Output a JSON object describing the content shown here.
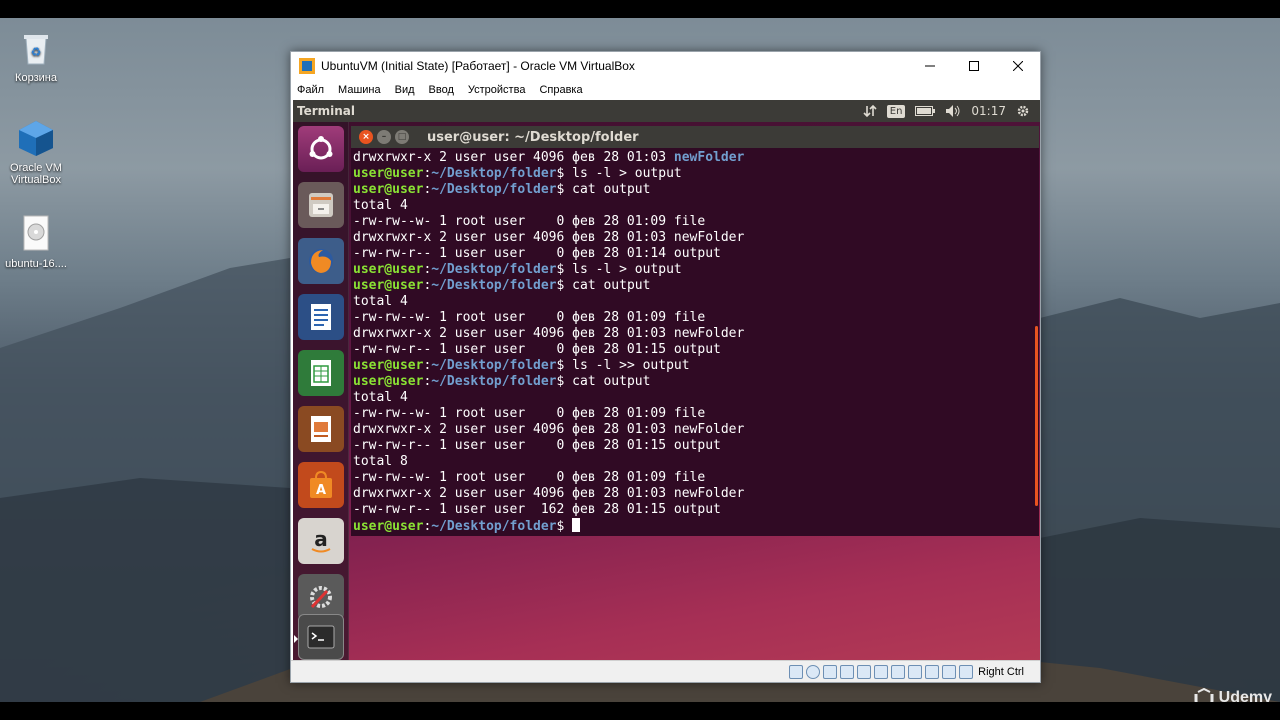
{
  "host_desktop": {
    "icons": [
      {
        "label": "Корзина",
        "icon": "recycle-bin-icon"
      },
      {
        "label": "Oracle VM VirtualBox",
        "icon": "virtualbox-icon"
      },
      {
        "label": "ubuntu-16....",
        "icon": "disk-image-icon"
      }
    ]
  },
  "vbox": {
    "title": "UbuntuVM (Initial State) [Работает] - Oracle VM VirtualBox",
    "menu": [
      "Файл",
      "Машина",
      "Вид",
      "Ввод",
      "Устройства",
      "Справка"
    ],
    "host_key": "Right Ctrl"
  },
  "guest": {
    "topbar": {
      "title": "Terminal",
      "language": "En",
      "time": "01:17"
    },
    "launcher": [
      "ubuntu-dash-icon",
      "files-icon",
      "firefox-icon",
      "writer-icon",
      "calc-icon",
      "impress-icon",
      "software-center-icon",
      "amazon-icon",
      "system-settings-icon",
      "terminal-icon"
    ],
    "terminal": {
      "title": "user@user: ~/Desktop/folder",
      "prompt_user": "user@user",
      "prompt_path": "~/Desktop/folder",
      "lines": [
        {
          "type": "dirline",
          "text": "drwxrwxr-x 2 user user 4096 фев 28 01:03 ",
          "dir": "newFolder"
        },
        {
          "type": "prompt",
          "cmd": " ls -l > output"
        },
        {
          "type": "prompt",
          "cmd": " cat output"
        },
        {
          "type": "out",
          "text": "total 4"
        },
        {
          "type": "out",
          "text": "-rw-rw--w- 1 root user    0 фев 28 01:09 file"
        },
        {
          "type": "out",
          "text": "drwxrwxr-x 2 user user 4096 фев 28 01:03 newFolder"
        },
        {
          "type": "out",
          "text": "-rw-rw-r-- 1 user user    0 фев 28 01:14 output"
        },
        {
          "type": "prompt",
          "cmd": " ls -l > output"
        },
        {
          "type": "prompt",
          "cmd": " cat output"
        },
        {
          "type": "out",
          "text": "total 4"
        },
        {
          "type": "out",
          "text": "-rw-rw--w- 1 root user    0 фев 28 01:09 file"
        },
        {
          "type": "out",
          "text": "drwxrwxr-x 2 user user 4096 фев 28 01:03 newFolder"
        },
        {
          "type": "out",
          "text": "-rw-rw-r-- 1 user user    0 фев 28 01:15 output"
        },
        {
          "type": "prompt",
          "cmd": " ls -l >> output"
        },
        {
          "type": "prompt",
          "cmd": " cat output"
        },
        {
          "type": "out",
          "text": "total 4"
        },
        {
          "type": "out",
          "text": "-rw-rw--w- 1 root user    0 фев 28 01:09 file"
        },
        {
          "type": "out",
          "text": "drwxrwxr-x 2 user user 4096 фев 28 01:03 newFolder"
        },
        {
          "type": "out",
          "text": "-rw-rw-r-- 1 user user    0 фев 28 01:15 output"
        },
        {
          "type": "out",
          "text": "total 8"
        },
        {
          "type": "out",
          "text": "-rw-rw--w- 1 root user    0 фев 28 01:09 file"
        },
        {
          "type": "out",
          "text": "drwxrwxr-x 2 user user 4096 фев 28 01:03 newFolder"
        },
        {
          "type": "out",
          "text": "-rw-rw-r-- 1 user user  162 фев 28 01:15 output"
        },
        {
          "type": "prompt_cursor",
          "cmd": " "
        }
      ]
    }
  },
  "watermark": "Udemy",
  "colors": {
    "prompt_user": "#8ae234",
    "prompt_path": "#729fcf",
    "terminal_bg": "#300a24",
    "ubuntu_orange": "#e95420"
  }
}
